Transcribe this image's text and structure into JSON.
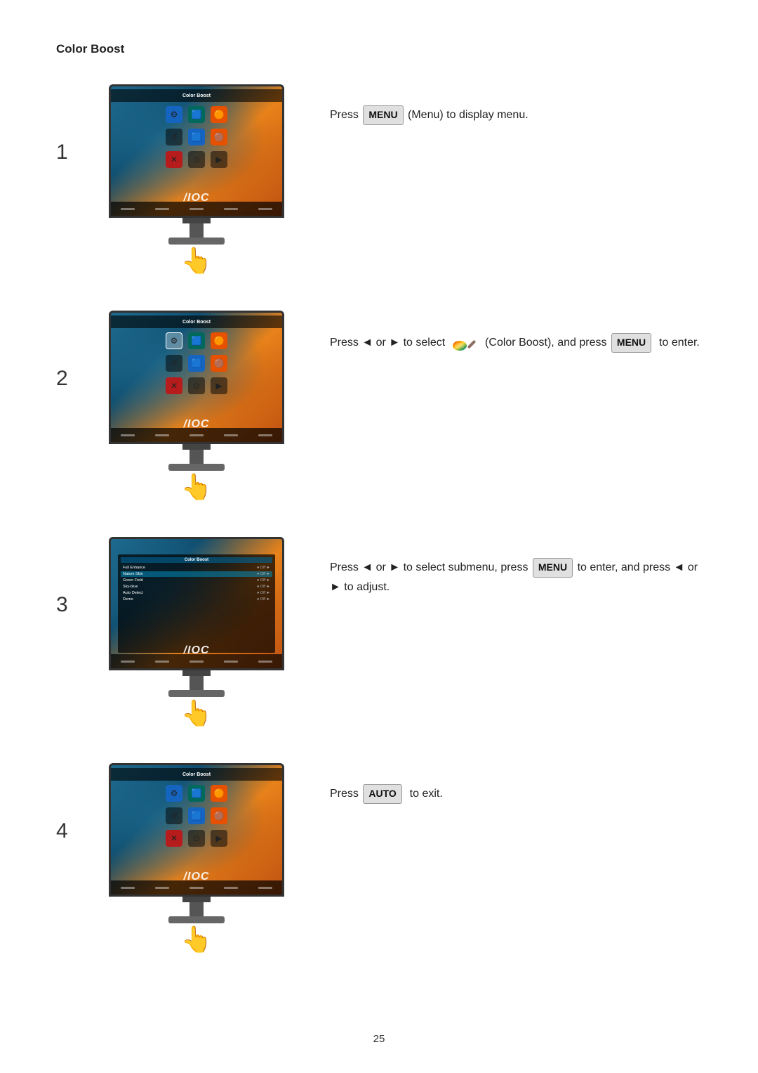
{
  "page": {
    "title": "Color Boost",
    "page_number": "25"
  },
  "steps": [
    {
      "number": "1",
      "description_parts": [
        {
          "type": "text",
          "content": "Press "
        },
        {
          "type": "key",
          "content": "MENU"
        },
        {
          "type": "text",
          "content": " (Menu) to display menu."
        }
      ],
      "screen_type": "main_menu"
    },
    {
      "number": "2",
      "description_parts": [
        {
          "type": "text",
          "content": "Press ◄ or ► to select"
        },
        {
          "type": "rainbow",
          "content": ""
        },
        {
          "type": "text",
          "content": " (Color Boost), and press "
        },
        {
          "type": "key",
          "content": "MENU"
        },
        {
          "type": "text",
          "content": " to enter."
        }
      ],
      "screen_type": "main_menu_selected"
    },
    {
      "number": "3",
      "description_parts": [
        {
          "type": "text",
          "content": "Press ◄ or ► to select submenu, press "
        },
        {
          "type": "key",
          "content": "MENU"
        },
        {
          "type": "text",
          "content": " to enter, and press ◄ or ► to adjust."
        }
      ],
      "screen_type": "submenu"
    },
    {
      "number": "4",
      "description_parts": [
        {
          "type": "text",
          "content": "Press "
        },
        {
          "type": "key",
          "content": "AUTO"
        },
        {
          "type": "text",
          "content": " to exit."
        }
      ],
      "screen_type": "main_menu"
    }
  ],
  "submenu_items": [
    {
      "label": "Full Enhance",
      "value": "Off",
      "arrow": true
    },
    {
      "label": "Nature Skin",
      "value": "Off",
      "arrow": true
    },
    {
      "label": "Green Field",
      "value": "Off",
      "arrow": true,
      "selected": true
    },
    {
      "label": "Sky-blue",
      "value": "Off",
      "arrow": true
    },
    {
      "label": "Auto Detect",
      "value": "Off",
      "arrow": true
    },
    {
      "label": "Demo",
      "value": "Off",
      "arrow": true
    }
  ]
}
